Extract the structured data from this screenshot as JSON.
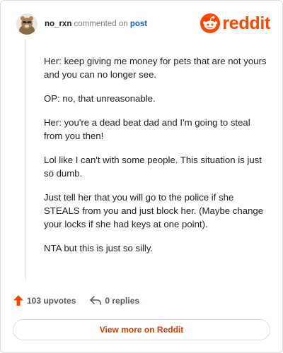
{
  "header": {
    "username": "no_rxn",
    "commented_on": "commented on",
    "post_link": "post"
  },
  "logo": {
    "word": "reddit",
    "icon": "reddit-snoo-icon",
    "color": "#ff4500"
  },
  "comment": {
    "paragraphs": [
      "Her: keep giving me money for pets that are not yours and you can no longer see.",
      "OP: no, that unreasonable.",
      "Her: you're a dead beat dad and I'm going to steal from you then!",
      "Lol like I can't with some people. This situation is just so dumb.",
      "Just tell her that you will go to the police if she STEALS from you and just block her. (Maybe change your locks if she had keys at one point).",
      "NTA but this is just so silly."
    ]
  },
  "actions": {
    "upvotes": "103 upvotes",
    "upvote_icon": "upvote-arrow-icon",
    "replies": "0 replies",
    "reply_icon": "reply-arrow-icon"
  },
  "footer": {
    "view_more": "View more on Reddit"
  }
}
